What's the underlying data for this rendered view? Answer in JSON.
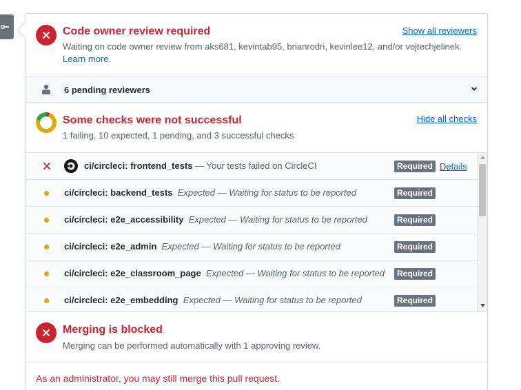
{
  "merge_tab": {
    "icon": "git-merge-icon"
  },
  "code_owner": {
    "title": "Code owner review required",
    "description": "Waiting on code owner review from aks681, kevintab95, brianrodri, kevinlee12, and/or vojtechjelinek.",
    "learn_more": "Learn more.",
    "show_all_reviewers": "Show all reviewers",
    "status_color": "#cb2431"
  },
  "reviewers": {
    "label": "6 pending reviewers",
    "icon": "person-icon"
  },
  "checks_header": {
    "title": "Some checks were not successful",
    "summary": "1 failing, 10 expected, 1 pending, and 3 successful checks",
    "hide_all": "Hide all checks",
    "donut_colors": {
      "success": "#28a745",
      "pending": "#dbab09",
      "failure": "#cb2431"
    }
  },
  "checks": [
    {
      "status": "failure",
      "name": "ci/circleci: frontend_tests",
      "detail": "— Your tests failed on CircleCI",
      "badge": "Required",
      "details_link": "Details"
    },
    {
      "status": "expected",
      "name": "ci/circleci: backend_tests",
      "detail": "Expected — Waiting for status to be reported",
      "badge": "Required"
    },
    {
      "status": "expected",
      "name": "ci/circleci: e2e_accessibility",
      "detail": "Expected — Waiting for status to be reported",
      "badge": "Required"
    },
    {
      "status": "expected",
      "name": "ci/circleci: e2e_admin",
      "detail": "Expected — Waiting for status to be reported",
      "badge": "Required"
    },
    {
      "status": "expected",
      "name": "ci/circleci: e2e_classroom_page",
      "detail": "Expected — Waiting for status to be reported",
      "badge": "Required"
    },
    {
      "status": "expected",
      "name": "ci/circleci: e2e_embedding",
      "detail": "Expected — Waiting for status to be reported",
      "badge": "Required"
    }
  ],
  "merging": {
    "title": "Merging is blocked",
    "description": "Merging can be performed automatically with 1 approving review."
  },
  "admin_note": "As an administrator, you may still merge this pull request."
}
